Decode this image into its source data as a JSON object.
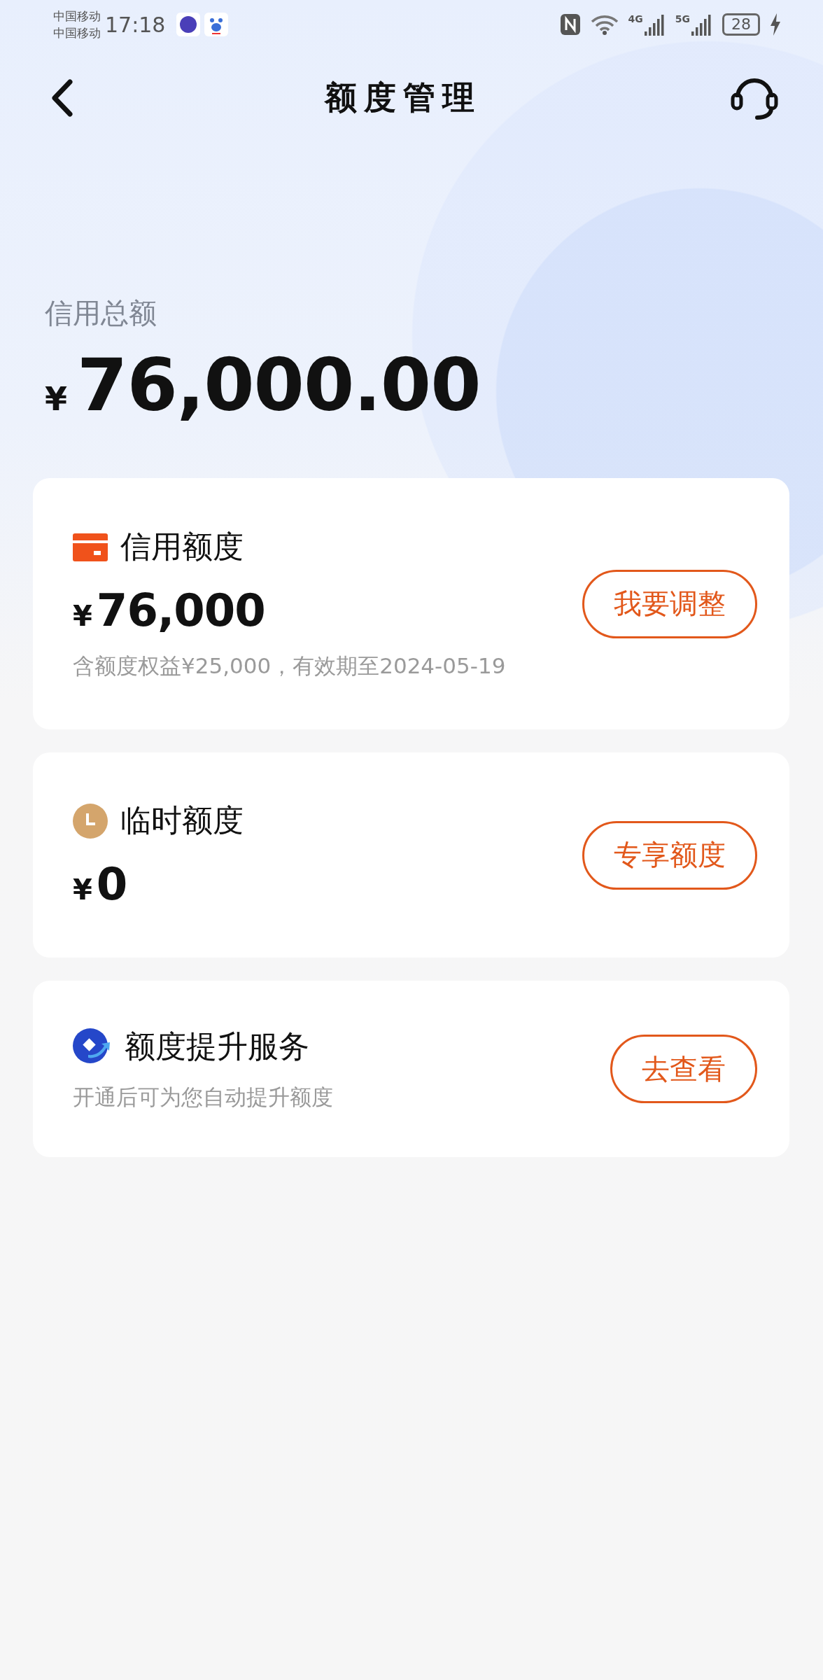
{
  "status_bar": {
    "carriers": [
      "中国移动",
      "中国移动"
    ],
    "time": "17:18",
    "networks": [
      "4G",
      "5G"
    ],
    "battery": "28"
  },
  "header": {
    "title": "额度管理"
  },
  "total": {
    "label": "信用总额",
    "currency": "¥",
    "amount": "76,000.00"
  },
  "cards": [
    {
      "kind": "card",
      "title": "信用额度",
      "currency": "¥",
      "amount": "76,000",
      "note": "含额度权益¥25,000，有效期至2024-05-19",
      "button": "我要调整"
    },
    {
      "kind": "clock",
      "title": "临时额度",
      "currency": "¥",
      "amount": "0",
      "button": "专享额度"
    },
    {
      "kind": "boost",
      "title": "额度提升服务",
      "note": "开通后可为您自动提升额度",
      "button": "去查看"
    }
  ]
}
